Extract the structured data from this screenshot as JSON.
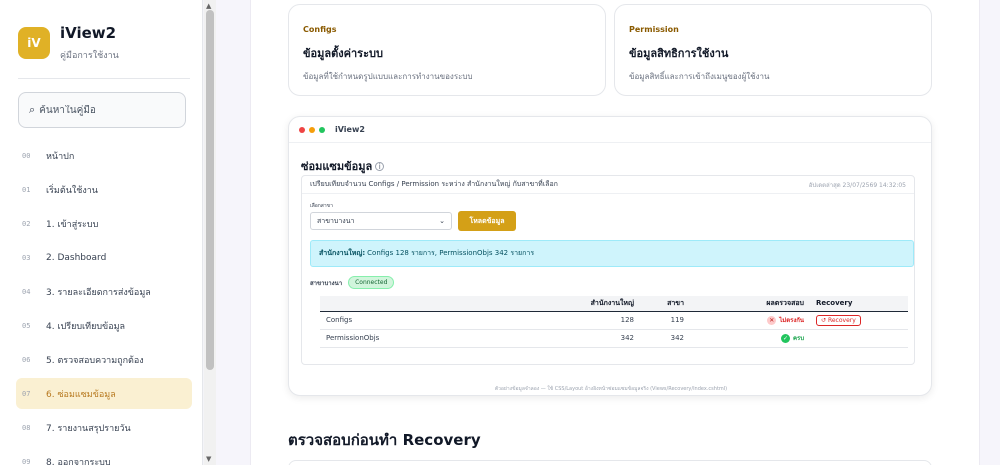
{
  "brand": {
    "logo": "iV",
    "title": "iView2",
    "subtitle": "คู่มือการใช้งาน"
  },
  "search": {
    "placeholder": "ค้นหาในคู่มือ"
  },
  "nav": [
    {
      "num": "00",
      "label": "หน้าปก"
    },
    {
      "num": "01",
      "label": "เริ่มต้นใช้งาน"
    },
    {
      "num": "02",
      "label": "1. เข้าสู่ระบบ"
    },
    {
      "num": "03",
      "label": "2. Dashboard"
    },
    {
      "num": "04",
      "label": "3. รายละเอียดการส่งข้อมูล"
    },
    {
      "num": "05",
      "label": "4. เปรียบเทียบข้อมูล"
    },
    {
      "num": "06",
      "label": "5. ตรวจสอบความถูกต้อง"
    },
    {
      "num": "07",
      "label": "6. ซ่อมแซมข้อมูล"
    },
    {
      "num": "08",
      "label": "7. รายงานสรุปรายวัน"
    },
    {
      "num": "09",
      "label": "8. ออกจากระบบ"
    }
  ],
  "cards": [
    {
      "tag": "Configs",
      "title": "ข้อมูลตั้งค่าระบบ",
      "desc": "ข้อมูลที่ใช้กำหนดรูปแบบและการทำงานของระบบ"
    },
    {
      "tag": "Permission",
      "title": "ข้อมูลสิทธิการใช้งาน",
      "desc": "ข้อมูลสิทธิ์และการเข้าถึงเมนูของผู้ใช้งาน"
    }
  ],
  "window": {
    "title": "iView2",
    "heading": "ซ่อมแซมข้อมูล",
    "compare_title": "เปรียบเทียบจำนวน Configs / Permission ระหว่าง สำนักงานใหญ่ กับสาขาที่เลือก",
    "updated": "อัปเดตล่าสุด 23/07/2569 14:32:05",
    "branch_label": "เลือกสาขา",
    "branch_selected": "สาขาบางนา",
    "load_button": "โหลดข้อมูล",
    "alert_bold": "สำนักงานใหญ่:",
    "alert_text": "Configs 128 รายการ, PermissionObjs 342 รายการ",
    "branch_name": "สาขาบางนา",
    "branch_status": "Connected",
    "table": {
      "headers": [
        "",
        "สำนักงานใหญ่",
        "สาขา",
        "ผลตรวจสอบ",
        "Recovery"
      ],
      "rows": [
        {
          "name": "Configs",
          "hq": "128",
          "branch": "119",
          "result": "ไม่ตรงกัน",
          "recovery": "Recovery"
        },
        {
          "name": "PermissionObjs",
          "hq": "342",
          "branch": "342",
          "result": "ครบ",
          "recovery": ""
        }
      ]
    },
    "footer": "ตัวอย่างข้อมูลจำลอง — ใช้ CSS/Layout อ้างอิงหน้าซ่อมแซมข้อมูลจริง (Views/Recovery/Index.cshtml)"
  },
  "section": {
    "title": "ตรวจสอบก่อนทำ Recovery"
  },
  "colors": {
    "accent": "#e0b126",
    "button": "#d4a017",
    "alert_bg": "#cff4fc",
    "danger": "#dc2626",
    "success": "#16a34a"
  }
}
